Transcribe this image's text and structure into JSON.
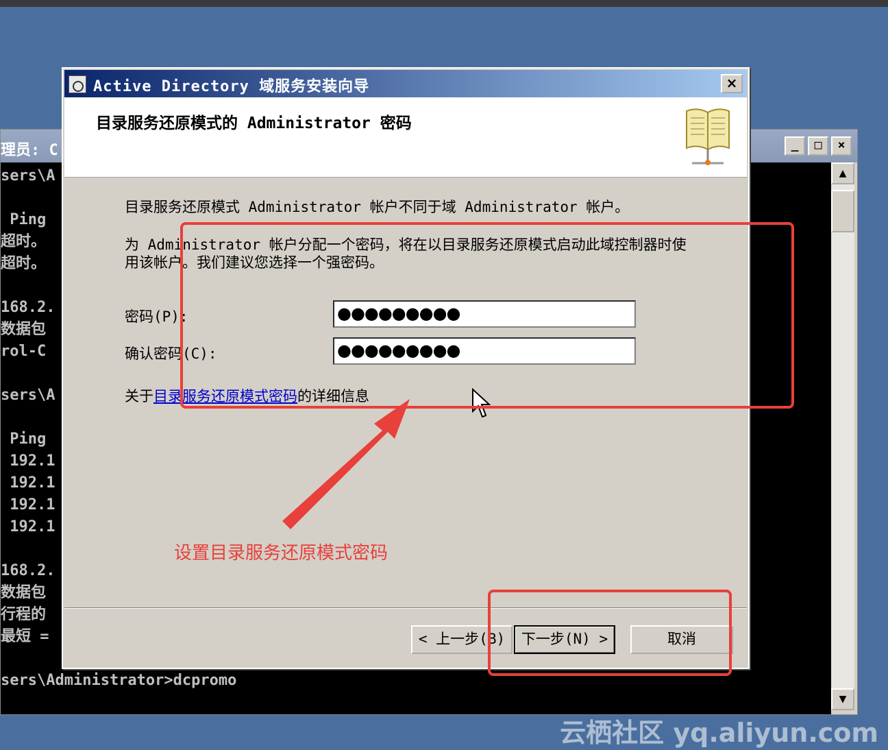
{
  "console": {
    "title": "理员: C",
    "lines": [
      "sers\\A",
      "",
      " Ping",
      "超时。",
      "超时。",
      "",
      "168.2.",
      "数据包",
      "rol-C",
      "",
      "sers\\A",
      "",
      " Ping",
      " 192.1",
      " 192.1",
      " 192.1",
      " 192.1",
      "",
      "168.2.",
      "数据包",
      "行程的",
      "最短 =",
      "",
      "sers\\Administrator>dcpromo"
    ],
    "btn_min": "_",
    "btn_max": "□",
    "btn_close": "×"
  },
  "dialog": {
    "title": "Active Directory 域服务安装向导",
    "close": "×",
    "header_title": "目录服务还原模式的 Administrator 密码",
    "intro": "目录服务还原模式 Administrator 帐户不同于域 Administrator 帐户。",
    "desc": "为 Administrator 帐户分配一个密码，将在以目录服务还原模式启动此域控制器时使用该帐户。我们建议您选择一个强密码。",
    "password_label": "密码(P):",
    "password_value": "●●●●●●●●●",
    "confirm_label": "确认密码(C):",
    "confirm_value": "●●●●●●●●●",
    "more_prefix": "关于",
    "more_link": "目录服务还原模式密码",
    "more_suffix": "的详细信息",
    "back": "< 上一步(B)",
    "next": "下一步(N) >",
    "cancel": "取消"
  },
  "annotation": {
    "text": "设置目录服务还原模式密码",
    "color": "#e8403a"
  },
  "watermark": "云栖社区 yq.aliyun.com"
}
